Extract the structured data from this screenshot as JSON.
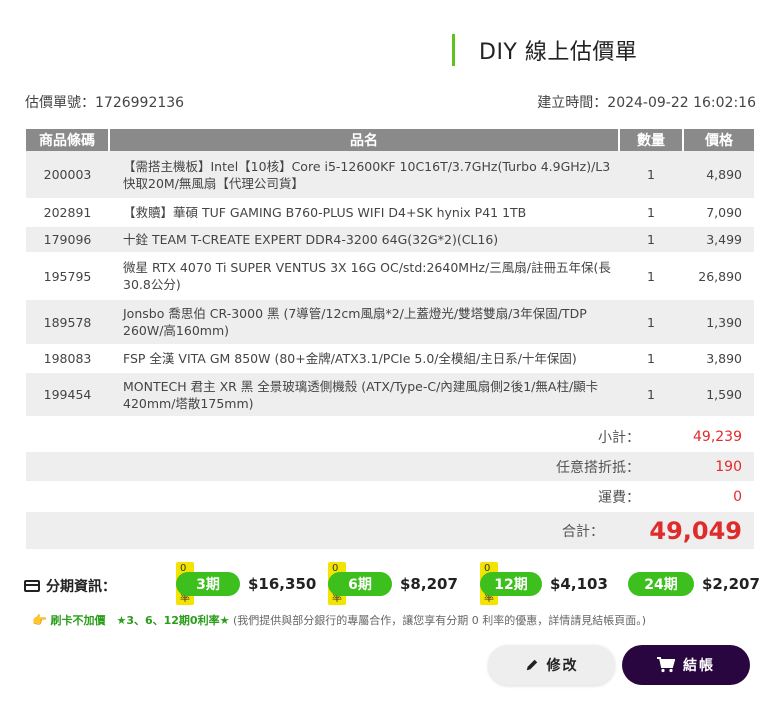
{
  "title": "DIY 線上估價單",
  "quote_number": "估價單號：1726992136",
  "created_at": "建立時間：2024-09-22 16:02:16",
  "table": {
    "headers": [
      "商品條碼",
      "品名",
      "數量",
      "價格"
    ],
    "rows": [
      {
        "code": "200003",
        "name": "【需搭主機板】Intel【10核】Core i5-12600KF 10C16T/3.7GHz(Turbo 4.9GHz)/L3快取20M/無風扇【代理公司貨】",
        "qty": "1",
        "price": "4,890"
      },
      {
        "code": "202891",
        "name": "【救贖】華碩 TUF GAMING B760-PLUS WIFI D4+SK hynix P41 1TB",
        "qty": "1",
        "price": "7,090"
      },
      {
        "code": "179096",
        "name": "十銓 TEAM T-CREATE EXPERT DDR4-3200 64G(32G*2)(CL16)",
        "qty": "1",
        "price": "3,499"
      },
      {
        "code": "195795",
        "name": "微星 RTX 4070 Ti SUPER VENTUS 3X 16G OC/std:2640MHz/三風扇/註冊五年保(長30.8公分)",
        "qty": "1",
        "price": "26,890"
      },
      {
        "code": "189578",
        "name": "Jonsbo 喬思伯 CR-3000 黑 (7導管/12cm風扇*2/上蓋燈光/雙塔雙扇/3年保固/TDP 260W/高160mm)",
        "qty": "1",
        "price": "1,390"
      },
      {
        "code": "198083",
        "name": "FSP 全漢 VITA GM 850W (80+金牌/ATX3.1/PCIe 5.0/全模組/主日系/十年保固)",
        "qty": "1",
        "price": "3,890"
      },
      {
        "code": "199454",
        "name": "MONTECH 君主 XR 黑 全景玻璃透側機殼 (ATX/Type-C/內建風扇側2後1/無A柱/顯卡420mm/塔散175mm)",
        "qty": "1",
        "price": "1,590"
      }
    ]
  },
  "summary": {
    "subtotal_label": "小計：",
    "subtotal": "49,239",
    "discount_label": "任意搭折抵：",
    "discount": "190",
    "shipping_label": "運費：",
    "shipping": "0",
    "total_label": "合計：",
    "total": "49,049"
  },
  "installment": {
    "label": "分期資訊：",
    "plans": [
      {
        "tag": "0利率",
        "period": "3期",
        "amount": "$16,350"
      },
      {
        "tag": "0利率",
        "period": "6期",
        "amount": "$8,207"
      },
      {
        "tag": "0利率",
        "period": "12期",
        "amount": "$4,103"
      },
      {
        "tag": "",
        "period": "24期",
        "amount": "$2,207"
      }
    ]
  },
  "promo": {
    "hand": "👉",
    "bold": "刷卡不加價　★3、6、12期0利率★",
    "text": "(我們提供與部分銀行的專屬合作，讓您享有分期 0 利率的優惠，詳情請見結帳頁面。)"
  },
  "buttons": {
    "edit": "修改",
    "checkout": "結帳"
  },
  "colors": {
    "accent_green": "#3dbf1e",
    "price_red": "#e02b2b",
    "checkout_bg": "#2a0640",
    "tag_yellow": "#f2e400"
  }
}
